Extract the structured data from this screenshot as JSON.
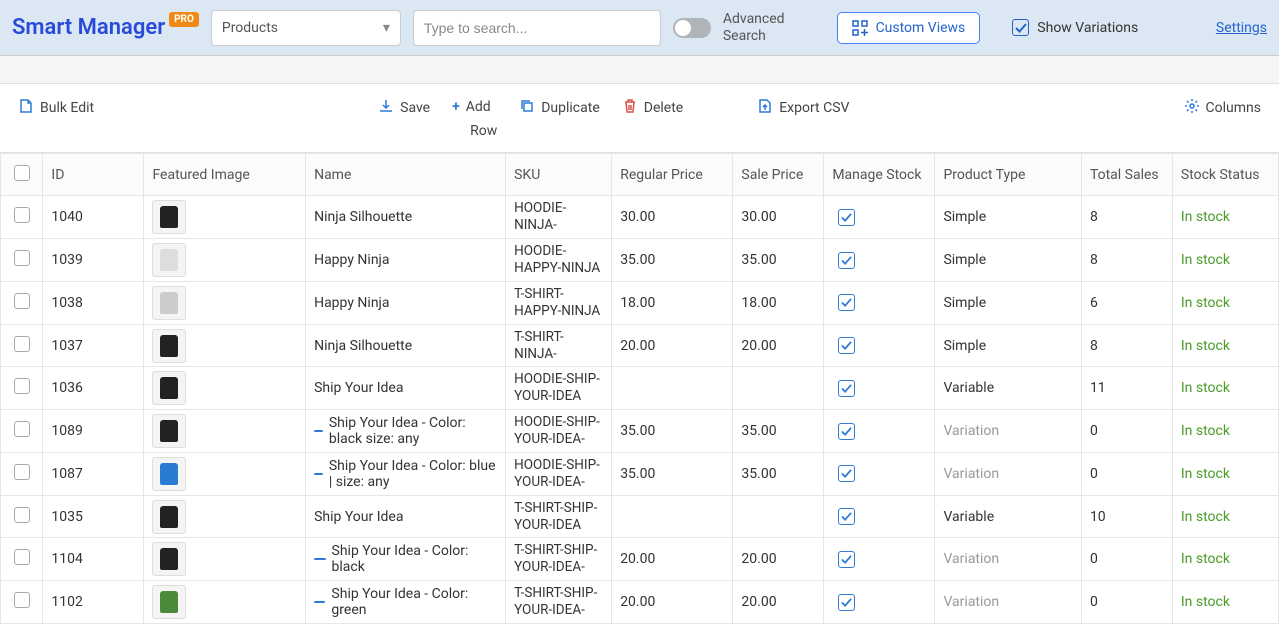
{
  "brand": {
    "name": "Smart Manager",
    "badge": "PRO"
  },
  "entity_selector": {
    "value": "Products"
  },
  "search": {
    "placeholder": "Type to search..."
  },
  "advanced_search": {
    "line1": "Advanced",
    "line2": "Search"
  },
  "custom_views": {
    "label": "Custom Views"
  },
  "show_variations": {
    "label": "Show Variations",
    "checked": true
  },
  "settings_link": {
    "label": "Settings"
  },
  "toolbar": {
    "bulk_edit": "Bulk Edit",
    "save": "Save",
    "add_row_line1": "Add",
    "add_row_line2": "Row",
    "duplicate": "Duplicate",
    "delete": "Delete",
    "export_csv": "Export CSV",
    "columns": "Columns"
  },
  "columns": {
    "id": "ID",
    "featured_image": "Featured Image",
    "name": "Name",
    "sku": "SKU",
    "regular_price": "Regular Price",
    "sale_price": "Sale Price",
    "manage_stock": "Manage Stock",
    "product_type": "Product Type",
    "total_sales": "Total Sales",
    "stock_status": "Stock Status"
  },
  "rows": [
    {
      "id": "1040",
      "name": "Ninja Silhouette",
      "sku": "HOODIE-NINJA-",
      "rprice": "30.00",
      "sprice": "30.00",
      "mstock": true,
      "ptype": "Simple",
      "sales": "8",
      "stock": "In stock",
      "thumb": "#222",
      "indent": false
    },
    {
      "id": "1039",
      "name": "Happy Ninja",
      "sku": "HOODIE-HAPPY-NINJA",
      "rprice": "35.00",
      "sprice": "35.00",
      "mstock": true,
      "ptype": "Simple",
      "sales": "8",
      "stock": "In stock",
      "thumb": "#ddd",
      "indent": false
    },
    {
      "id": "1038",
      "name": "Happy Ninja",
      "sku": "T-SHIRT-HAPPY-NINJA",
      "rprice": "18.00",
      "sprice": "18.00",
      "mstock": true,
      "ptype": "Simple",
      "sales": "6",
      "stock": "In stock",
      "thumb": "#ccc",
      "indent": false
    },
    {
      "id": "1037",
      "name": "Ninja Silhouette",
      "sku": "T-SHIRT-NINJA-",
      "rprice": "20.00",
      "sprice": "20.00",
      "mstock": true,
      "ptype": "Simple",
      "sales": "8",
      "stock": "In stock",
      "thumb": "#222",
      "indent": false
    },
    {
      "id": "1036",
      "name": "Ship Your Idea",
      "sku": "HOODIE-SHIP-YOUR-IDEA",
      "rprice": "",
      "sprice": "",
      "mstock": true,
      "ptype": "Variable",
      "sales": "11",
      "stock": "In stock",
      "thumb": "#222",
      "indent": false
    },
    {
      "id": "1089",
      "name": "Ship Your Idea - Color: black size: any",
      "sku": "HOODIE-SHIP-YOUR-IDEA-",
      "rprice": "35.00",
      "sprice": "35.00",
      "mstock": true,
      "ptype": "Variation",
      "sales": "0",
      "stock": "In stock",
      "thumb": "#222",
      "indent": true
    },
    {
      "id": "1087",
      "name": "Ship Your Idea - Color: blue | size: any",
      "sku": "HOODIE-SHIP-YOUR-IDEA-",
      "rprice": "35.00",
      "sprice": "35.00",
      "mstock": true,
      "ptype": "Variation",
      "sales": "0",
      "stock": "In stock",
      "thumb": "#2a7bd4",
      "indent": true
    },
    {
      "id": "1035",
      "name": "Ship Your Idea",
      "sku": "T-SHIRT-SHIP-YOUR-IDEA",
      "rprice": "",
      "sprice": "",
      "mstock": true,
      "ptype": "Variable",
      "sales": "10",
      "stock": "In stock",
      "thumb": "#222",
      "indent": false
    },
    {
      "id": "1104",
      "name": "Ship Your Idea - Color: black",
      "sku": "T-SHIRT-SHIP-YOUR-IDEA-",
      "rprice": "20.00",
      "sprice": "20.00",
      "mstock": true,
      "ptype": "Variation",
      "sales": "0",
      "stock": "In stock",
      "thumb": "#222",
      "indent": true
    },
    {
      "id": "1102",
      "name": "Ship Your Idea - Color: green",
      "sku": "T-SHIRT-SHIP-YOUR-IDEA-",
      "rprice": "20.00",
      "sprice": "20.00",
      "mstock": true,
      "ptype": "Variation",
      "sales": "0",
      "stock": "In stock",
      "thumb": "#4b8a3a",
      "indent": true
    }
  ]
}
